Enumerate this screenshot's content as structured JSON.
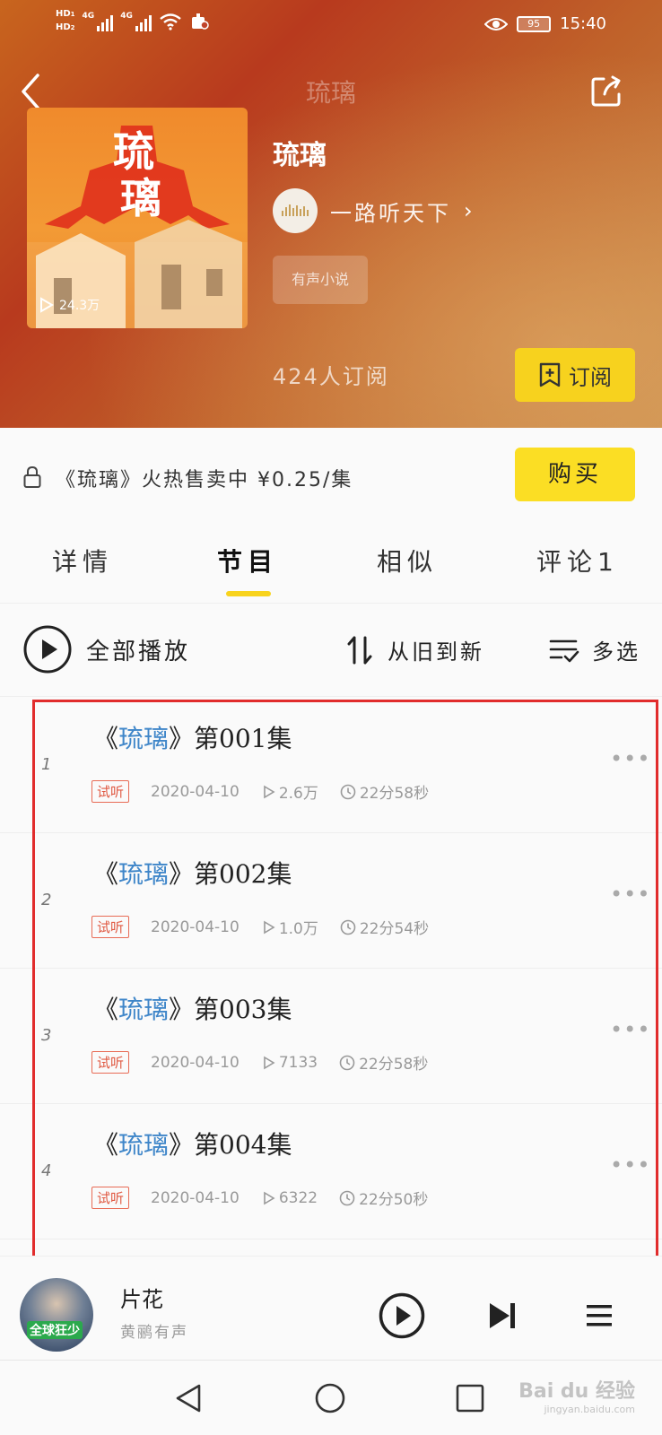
{
  "status_bar": {
    "hd1": "HD",
    "hd2": "HD",
    "lte1": "4G",
    "lte2": "4G",
    "battery": "95",
    "time": "15:40"
  },
  "header": {
    "nav_title": "琉璃",
    "book_title": "琉璃",
    "cover_title_line1": "琉",
    "cover_title_line2": "璃",
    "cover_plays": "24.3万",
    "author_name": "一路听天下",
    "tag": "有声小说",
    "subscribers": "424人订阅",
    "subscribe_label": "订阅"
  },
  "buy_bar": {
    "text": "《琉璃》火热售卖中 ¥0.25/集",
    "buy_label": "购买"
  },
  "tabs": [
    {
      "label": "详情"
    },
    {
      "label": "节目"
    },
    {
      "label": "相似"
    },
    {
      "label": "评论1"
    }
  ],
  "toolbar": {
    "play_all": "全部播放",
    "sort": "从旧到新",
    "multi_select": "多选"
  },
  "episodes": [
    {
      "num": "1",
      "title_prefix": "《",
      "title_name": "琉璃",
      "title_suffix": "》第001集",
      "badge": "试听",
      "date": "2020-04-10",
      "plays": "2.6万",
      "duration": "22分58秒"
    },
    {
      "num": "2",
      "title_prefix": "《",
      "title_name": "琉璃",
      "title_suffix": "》第002集",
      "badge": "试听",
      "date": "2020-04-10",
      "plays": "1.0万",
      "duration": "22分54秒"
    },
    {
      "num": "3",
      "title_prefix": "《",
      "title_name": "琉璃",
      "title_suffix": "》第003集",
      "badge": "试听",
      "date": "2020-04-10",
      "plays": "7133",
      "duration": "22分58秒"
    },
    {
      "num": "4",
      "title_prefix": "《",
      "title_name": "琉璃",
      "title_suffix": "》第004集",
      "badge": "试听",
      "date": "2020-04-10",
      "plays": "6322",
      "duration": "22分50秒"
    }
  ],
  "player": {
    "title": "片花",
    "artist": "黄鹂有声",
    "art_text": "全球狂少"
  },
  "watermark": {
    "main": "Bai du 经验",
    "sub": "jingyan.baidu.com"
  },
  "colors": {
    "accent_yellow": "#f8d31d",
    "link_blue": "#3f86c9",
    "trial_red": "#e05a43",
    "highlight_red": "#e12c2c"
  }
}
